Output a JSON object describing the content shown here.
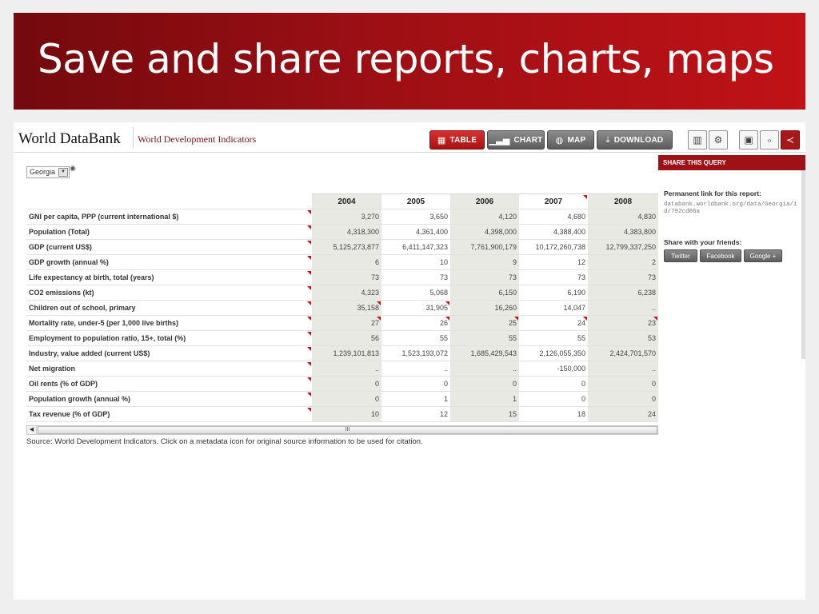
{
  "slide": {
    "title": "Save and share reports, charts, maps"
  },
  "app": {
    "brand": "World DataBank",
    "subtitle": "World Development Indicators",
    "toolbar": [
      {
        "label": "TABLE",
        "icon": "table-icon",
        "active": true
      },
      {
        "label": "CHART",
        "icon": "bar-chart-icon",
        "active": false
      },
      {
        "label": "MAP",
        "icon": "globe-icon",
        "active": false
      },
      {
        "label": "DOWNLOAD",
        "icon": "download-icon",
        "active": false
      }
    ],
    "tools": [
      "layout-icon",
      "gear-icon",
      "save-icon",
      "embed-icon",
      "share-icon"
    ],
    "country": {
      "selected": "Georgia"
    }
  },
  "table": {
    "years": [
      "2004",
      "2005",
      "2006",
      "2007",
      "2008"
    ],
    "rows": [
      {
        "label": "GNI per capita, PPP (current international $)",
        "values": [
          "3,270",
          "3,650",
          "4,120",
          "4,680",
          "4,830"
        ]
      },
      {
        "label": "Population (Total)",
        "values": [
          "4,318,300",
          "4,361,400",
          "4,398,000",
          "4,388,400",
          "4,383,800"
        ]
      },
      {
        "label": "GDP (current US$)",
        "values": [
          "5,125,273,877",
          "6,411,147,323",
          "7,761,900,179",
          "10,172,260,738",
          "12,799,337,250"
        ]
      },
      {
        "label": "GDP growth (annual %)",
        "values": [
          "6",
          "10",
          "9",
          "12",
          "2"
        ]
      },
      {
        "label": "Life expectancy at birth, total (years)",
        "values": [
          "73",
          "73",
          "73",
          "73",
          "73"
        ]
      },
      {
        "label": "CO2 emissions (kt)",
        "values": [
          "4,323",
          "5,068",
          "6,150",
          "6,190",
          "6,238"
        ]
      },
      {
        "label": "Children out of school, primary",
        "values": [
          "35,158",
          "31,905",
          "16,260",
          "14,047",
          ".."
        ]
      },
      {
        "label": "Mortality rate, under-5 (per 1,000 live births)",
        "values": [
          "27",
          "26",
          "25",
          "24",
          "23"
        ]
      },
      {
        "label": "Employment to population ratio, 15+, total (%)",
        "values": [
          "56",
          "55",
          "55",
          "55",
          "53"
        ]
      },
      {
        "label": "Industry, value added (current US$)",
        "values": [
          "1,239,101,813",
          "1,523,193,072",
          "1,685,429,543",
          "2,126,055,350",
          "2,424,701,570"
        ]
      },
      {
        "label": "Net migration",
        "values": [
          "..",
          "..",
          "..",
          "-150,000",
          ".."
        ]
      },
      {
        "label": "Oil rents (% of GDP)",
        "values": [
          "0",
          "0",
          "0",
          "0",
          "0"
        ]
      },
      {
        "label": "Population growth (annual %)",
        "values": [
          "0",
          "1",
          "1",
          "0",
          "0"
        ]
      },
      {
        "label": "Tax revenue (% of GDP)",
        "values": [
          "10",
          "12",
          "15",
          "18",
          "24"
        ]
      }
    ],
    "scroll_glyph": "III"
  },
  "source_note": "Source: World Development Indicators. Click on a metadata icon for original source information to be used for citation.",
  "share_panel": {
    "header": "SHARE THIS QUERY",
    "permalink_label": "Permanent link for this report:",
    "permalink": "databank.worldbank.org/data/Georgia/id/792cd06a",
    "friends_label": "Share with your friends:",
    "buttons": [
      "Twitter",
      "Facebook",
      "Google +"
    ]
  }
}
